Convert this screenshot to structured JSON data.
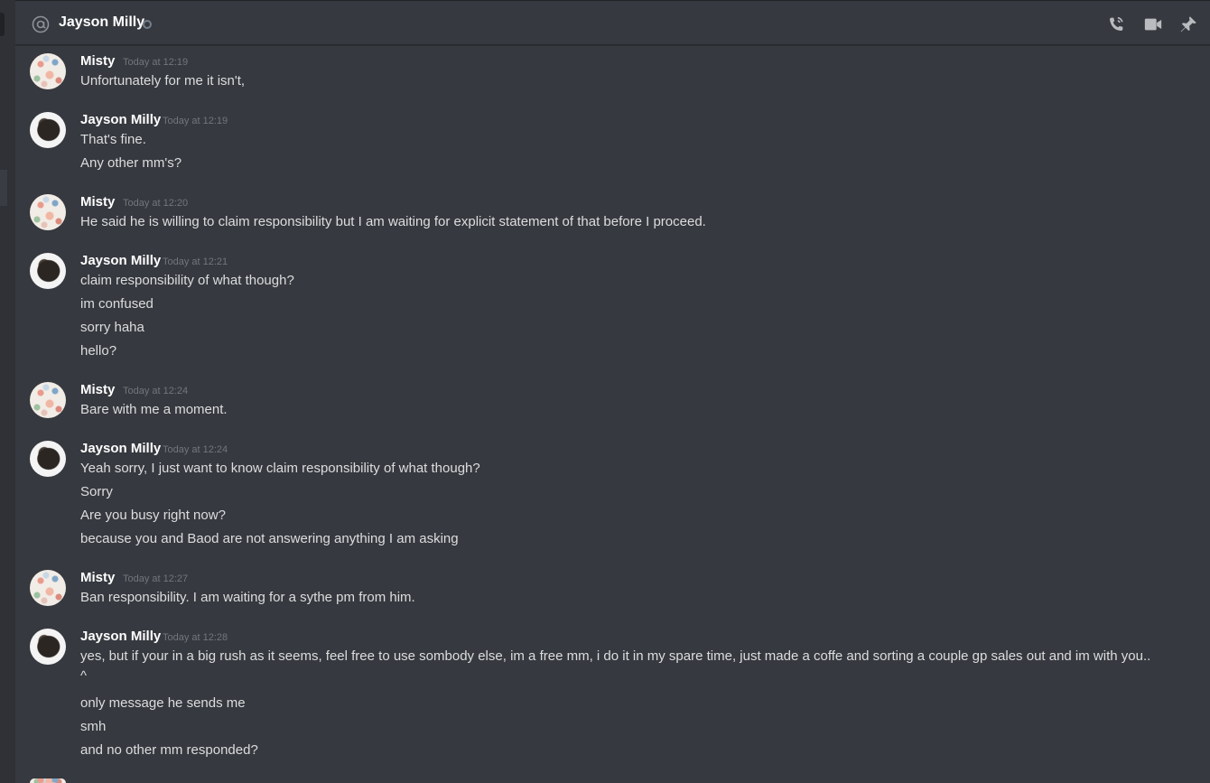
{
  "header": {
    "title": "Jayson Milly",
    "icons": [
      "at-icon",
      "call-icon",
      "video-icon",
      "pin-icon"
    ]
  },
  "groups": [
    {
      "user": "Misty",
      "time": "Today at 12:19",
      "lines": [
        "Unfortunately for me it isn't,"
      ]
    },
    {
      "user": "Jayson Milly",
      "time": "Today at 12:19",
      "lines": [
        "That's fine.",
        "Any other mm's?"
      ]
    },
    {
      "user": "Misty",
      "time": "Today at 12:20",
      "lines": [
        "He said he is willing to claim responsibility but I am waiting for explicit statement of that before I proceed."
      ]
    },
    {
      "user": "Jayson Milly",
      "time": "Today at 12:21",
      "lines": [
        "claim responsibility of what though?",
        "im confused",
        "sorry haha",
        "hello?"
      ]
    },
    {
      "user": "Misty",
      "time": "Today at 12:24",
      "lines": [
        "Bare with me a moment."
      ]
    },
    {
      "user": "Jayson Milly",
      "time": "Today at 12:24",
      "lines": [
        "Yeah sorry, I just want to know claim responsibility of what though?",
        "Sorry",
        "Are you busy right now?",
        "because you and Baod are not answering anything I am asking"
      ]
    },
    {
      "user": "Misty",
      "time": "Today at 12:27",
      "lines": [
        "Ban responsibility. I am waiting for a sythe pm from him."
      ]
    },
    {
      "user": "Jayson Milly",
      "time": "Today at 12:28",
      "lines": [
        "yes, but if your in a big rush as it seems, feel free to use sombody else, im a free mm, i do it in my spare time, just made a coffe and sorting a couple gp sales out and im with you..",
        "^",
        "only message he sends me",
        "smh",
        "and no other mm responded?"
      ]
    }
  ]
}
